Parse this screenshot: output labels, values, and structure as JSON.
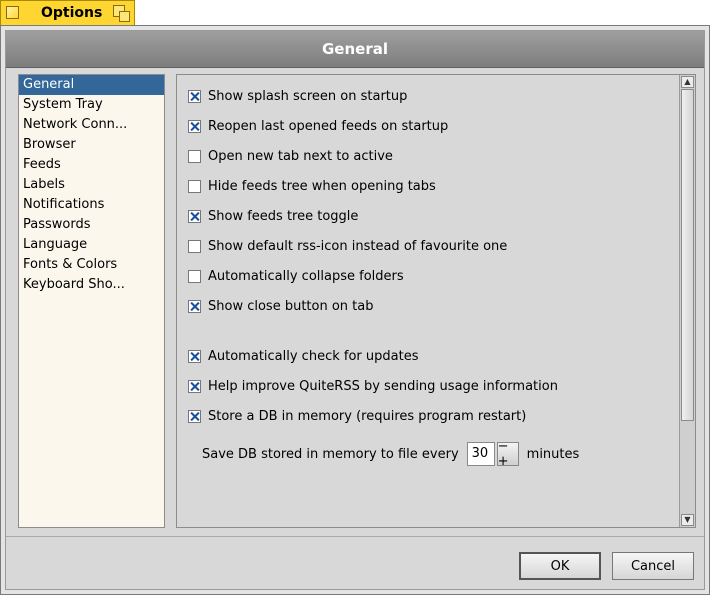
{
  "window": {
    "title": "Options",
    "colors": {
      "tab": "#ffd631",
      "selection": "#336699"
    }
  },
  "header": {
    "title": "General"
  },
  "categories": [
    {
      "label": "General",
      "selected": true
    },
    {
      "label": "System Tray"
    },
    {
      "label": "Network Conn..."
    },
    {
      "label": "Browser"
    },
    {
      "label": "Feeds"
    },
    {
      "label": "Labels"
    },
    {
      "label": "Notifications"
    },
    {
      "label": "Passwords"
    },
    {
      "label": "Language"
    },
    {
      "label": "Fonts & Colors"
    },
    {
      "label": "Keyboard Sho..."
    }
  ],
  "options": [
    {
      "label": "Show splash screen on startup",
      "checked": true
    },
    {
      "label": "Reopen last opened feeds on startup",
      "checked": true
    },
    {
      "label": "Open new tab next to active",
      "checked": false
    },
    {
      "label": "Hide feeds tree when opening tabs",
      "checked": false
    },
    {
      "label": "Show feeds tree toggle",
      "checked": true
    },
    {
      "label": "Show default rss-icon instead of favourite one",
      "checked": false
    },
    {
      "label": "Automatically collapse folders",
      "checked": false
    },
    {
      "label": "Show close button on tab",
      "checked": true
    },
    {
      "label": "Automatically check for updates",
      "checked": true
    },
    {
      "label": "Help improve QuiteRSS by sending usage information",
      "checked": true
    },
    {
      "label": "Store a DB in memory (requires program restart)",
      "checked": true
    }
  ],
  "save_db": {
    "label": "Save DB stored in memory to file every",
    "value": "30",
    "stepper": "−+",
    "suffix": "minutes"
  },
  "buttons": {
    "ok": "OK",
    "cancel": "Cancel"
  }
}
